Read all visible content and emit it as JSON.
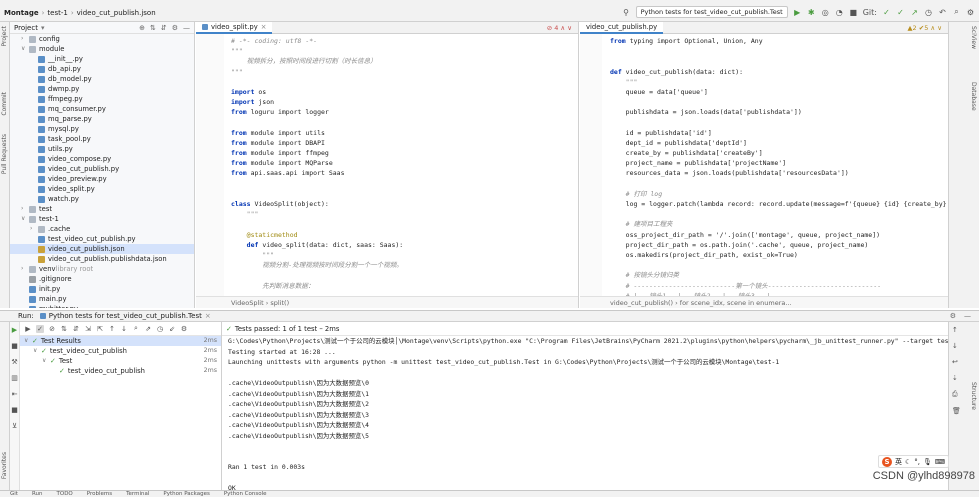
{
  "nav": {
    "crumbs": [
      "Montage",
      "test-1",
      "video_cut_publish.json"
    ]
  },
  "toolbar": {
    "run_config": "Python tests for test_video_cut_publish.Test",
    "git_label": "Git:"
  },
  "project": {
    "title": "Project",
    "items": [
      {
        "label": "config",
        "indent": 1,
        "type": "folder",
        "arrow": ">"
      },
      {
        "label": "module",
        "indent": 1,
        "type": "folder",
        "arrow": "v"
      },
      {
        "label": "__init__.py",
        "indent": 2,
        "type": "py"
      },
      {
        "label": "db_api.py",
        "indent": 2,
        "type": "py"
      },
      {
        "label": "db_model.py",
        "indent": 2,
        "type": "py"
      },
      {
        "label": "dwmp.py",
        "indent": 2,
        "type": "py"
      },
      {
        "label": "ffmpeg.py",
        "indent": 2,
        "type": "py"
      },
      {
        "label": "mq_consumer.py",
        "indent": 2,
        "type": "py"
      },
      {
        "label": "mq_parse.py",
        "indent": 2,
        "type": "py"
      },
      {
        "label": "mysql.py",
        "indent": 2,
        "type": "py"
      },
      {
        "label": "task_pool.py",
        "indent": 2,
        "type": "py"
      },
      {
        "label": "utils.py",
        "indent": 2,
        "type": "py"
      },
      {
        "label": "video_compose.py",
        "indent": 2,
        "type": "py"
      },
      {
        "label": "video_cut_publish.py",
        "indent": 2,
        "type": "py"
      },
      {
        "label": "video_preview.py",
        "indent": 2,
        "type": "py"
      },
      {
        "label": "video_split.py",
        "indent": 2,
        "type": "py"
      },
      {
        "label": "watch.py",
        "indent": 2,
        "type": "py"
      },
      {
        "label": "test",
        "indent": 1,
        "type": "folder",
        "arrow": ">"
      },
      {
        "label": "test-1",
        "indent": 1,
        "type": "folder",
        "arrow": "v"
      },
      {
        "label": ".cache",
        "indent": 2,
        "type": "folder",
        "arrow": ">"
      },
      {
        "label": "test_video_cut_publish.py",
        "indent": 2,
        "type": "py"
      },
      {
        "label": "video_cut_publish.json",
        "indent": 2,
        "type": "json",
        "selected": true
      },
      {
        "label": "video_cut_publish.publishdata.json",
        "indent": 2,
        "type": "json"
      },
      {
        "label": "venv",
        "indent": 1,
        "type": "folder",
        "arrow": ">",
        "suffix": " library root"
      },
      {
        "label": ".gitignore",
        "indent": 1,
        "type": "txt"
      },
      {
        "label": "init.py",
        "indent": 1,
        "type": "py"
      },
      {
        "label": "main.py",
        "indent": 1,
        "type": "py"
      },
      {
        "label": "mybitter.py",
        "indent": 1,
        "type": "py"
      }
    ]
  },
  "editor_left": {
    "tab": "video_split.py",
    "warn": "4",
    "breadcrumb": "VideoSplit  ›  split()",
    "lines": [
      {
        "t": "# -*- coding: utf8 -*-",
        "c": "cm"
      },
      {
        "t": "\"\"\"",
        "c": "cm"
      },
      {
        "t": "    视频拆分，按照时间段进行切割（时长信息）",
        "c": "cm"
      },
      {
        "t": "\"\"\"",
        "c": "cm"
      },
      {
        "t": "",
        "c": ""
      },
      {
        "t": "import os",
        "c": "kw"
      },
      {
        "t": "import json",
        "c": "kw"
      },
      {
        "t": "from loguru import logger",
        "c": "kw"
      },
      {
        "t": "",
        "c": ""
      },
      {
        "t": "from module import utils",
        "c": "kw"
      },
      {
        "t": "from module import DBAPI",
        "c": "kw"
      },
      {
        "t": "from module import ffmpeg",
        "c": "kw"
      },
      {
        "t": "from module import MQParse",
        "c": "kw"
      },
      {
        "t": "from api.saas.api import Saas",
        "c": "kw"
      },
      {
        "t": "",
        "c": ""
      },
      {
        "t": "",
        "c": ""
      },
      {
        "t": "class VideoSplit(object):",
        "c": "kw"
      },
      {
        "t": "    \"\"\"",
        "c": "cm"
      },
      {
        "t": "",
        "c": ""
      },
      {
        "t": "    @staticmethod",
        "c": "deco"
      },
      {
        "t": "    def video_split(data: dict, saas: Saas):",
        "c": "kw"
      },
      {
        "t": "        \"\"\"",
        "c": "cm"
      },
      {
        "t": "        视频分割-处理视频按时间段分割一个一个视频。",
        "c": "cm"
      },
      {
        "t": "",
        "c": ""
      },
      {
        "t": "        先判断消息数据：",
        "c": "cm"
      }
    ]
  },
  "editor_right": {
    "tab": "video_cut_publish.py",
    "warn": "2",
    "warn2": "5",
    "breadcrumb": "video_cut_publish()  ›  for scene_idx, scene in enumera...",
    "lines": [
      {
        "t": "from typing import Optional, Union, Any",
        "c": "kw"
      },
      {
        "t": "",
        "c": ""
      },
      {
        "t": "",
        "c": ""
      },
      {
        "t": "def video_cut_publish(data: dict):",
        "c": "kw"
      },
      {
        "t": "    \"\"\"",
        "c": "cm"
      },
      {
        "t": "    queue = data['queue']",
        "c": ""
      },
      {
        "t": "",
        "c": ""
      },
      {
        "t": "    publishdata = json.loads(data['publishdata'])",
        "c": ""
      },
      {
        "t": "",
        "c": ""
      },
      {
        "t": "    id = publishdata['id']",
        "c": ""
      },
      {
        "t": "    dept_id = publishdata['deptId']",
        "c": ""
      },
      {
        "t": "    create_by = publishdata['createBy']",
        "c": ""
      },
      {
        "t": "    project_name = publishdata['projectName']",
        "c": ""
      },
      {
        "t": "    resources_data = json.loads(publishdata['resourcesData'])",
        "c": ""
      },
      {
        "t": "",
        "c": ""
      },
      {
        "t": "    # 打印 log",
        "c": "cm"
      },
      {
        "t": "    log = logger.patch(lambda record: record.update(message=f'{queue} {id} {create_by} {project_name",
        "c": ""
      },
      {
        "t": "",
        "c": ""
      },
      {
        "t": "    # 建项目工程夹",
        "c": "cm"
      },
      {
        "t": "    oss_project_dir_path = '/'.join(['montage', queue, project_name])",
        "c": ""
      },
      {
        "t": "    project_dir_path = os.path.join('.cache', queue, project_name)",
        "c": ""
      },
      {
        "t": "    os.makedirs(project_dir_path, exist_ok=True)",
        "c": ""
      },
      {
        "t": "",
        "c": ""
      },
      {
        "t": "    # 按镜头分镜归类",
        "c": "cm"
      },
      {
        "t": "    # --------------------------第一个镜头-----------------------------",
        "c": "cm"
      },
      {
        "t": "    # |   镜头1   |   镜头2   |   镜头3   |",
        "c": "cm"
      },
      {
        "t": "    # --------------------------第二个镜头-----------------------------",
        "c": "cm"
      }
    ]
  },
  "run": {
    "label": "Run:",
    "config": "Python tests for test_video_cut_publish.Test",
    "passed": "Tests passed: 1 of 1 test – 2ms",
    "tree": [
      {
        "label": "Test Results",
        "indent": 0,
        "dur": "2ms",
        "sel": true
      },
      {
        "label": "test_video_cut_publish",
        "indent": 1,
        "dur": "2ms"
      },
      {
        "label": "Test",
        "indent": 2,
        "dur": "2ms"
      },
      {
        "label": "test_video_cut_publish",
        "indent": 3,
        "dur": "2ms"
      }
    ],
    "console": [
      {
        "t": "G:\\Codes\\Python\\Projects\\测试一个于公司的云模块│\\Montage\\venv\\Scripts\\python.exe \"C:\\Program Files\\JetBrains\\PyCharm 2021.2\\plugins\\python\\helpers\\pycharm\\_jb_unittest_runner.py\" --target test_video_cut_publ",
        "c": ""
      },
      {
        "t": "Testing started at 16:28 ...",
        "c": ""
      },
      {
        "t": "Launching unittests with arguments python -m unittest test_video_cut_publish.Test in G:\\Codes\\Python\\Projects\\测试一个于公司的云模块\\Montage\\test-1",
        "c": ""
      },
      {
        "t": "",
        "c": ""
      },
      {
        "t": ".cache\\VideoOutpublish\\因为大数据预览\\0",
        "c": ""
      },
      {
        "t": ".cache\\VideoOutpublish\\因为大数据预览\\1",
        "c": ""
      },
      {
        "t": ".cache\\VideoOutpublish\\因为大数据预览\\2",
        "c": ""
      },
      {
        "t": ".cache\\VideoOutpublish\\因为大数据预览\\3",
        "c": ""
      },
      {
        "t": ".cache\\VideoOutpublish\\因为大数据预览\\4",
        "c": ""
      },
      {
        "t": ".cache\\VideoOutpublish\\因为大数据预览\\5",
        "c": ""
      },
      {
        "t": "",
        "c": ""
      },
      {
        "t": "",
        "c": ""
      },
      {
        "t": "Ran 1 test in 0.003s",
        "c": ""
      },
      {
        "t": "",
        "c": ""
      },
      {
        "t": "OK",
        "c": ""
      }
    ]
  },
  "side": {
    "project_tab": "Project",
    "commit_tab": "Commit",
    "pull_tab": "Pull Requests",
    "structure_tab": "Structure",
    "favorites_tab": "Favorites",
    "sciview_tab": "SciView",
    "database_tab": "Database"
  },
  "bottom": [
    "Git",
    "Run",
    "TODO",
    "Problems",
    "Terminal",
    "Python Packages",
    "Python Console"
  ],
  "watermark": "CSDN @ylhd898978",
  "ime": {
    "s": "S",
    "label": "英"
  }
}
